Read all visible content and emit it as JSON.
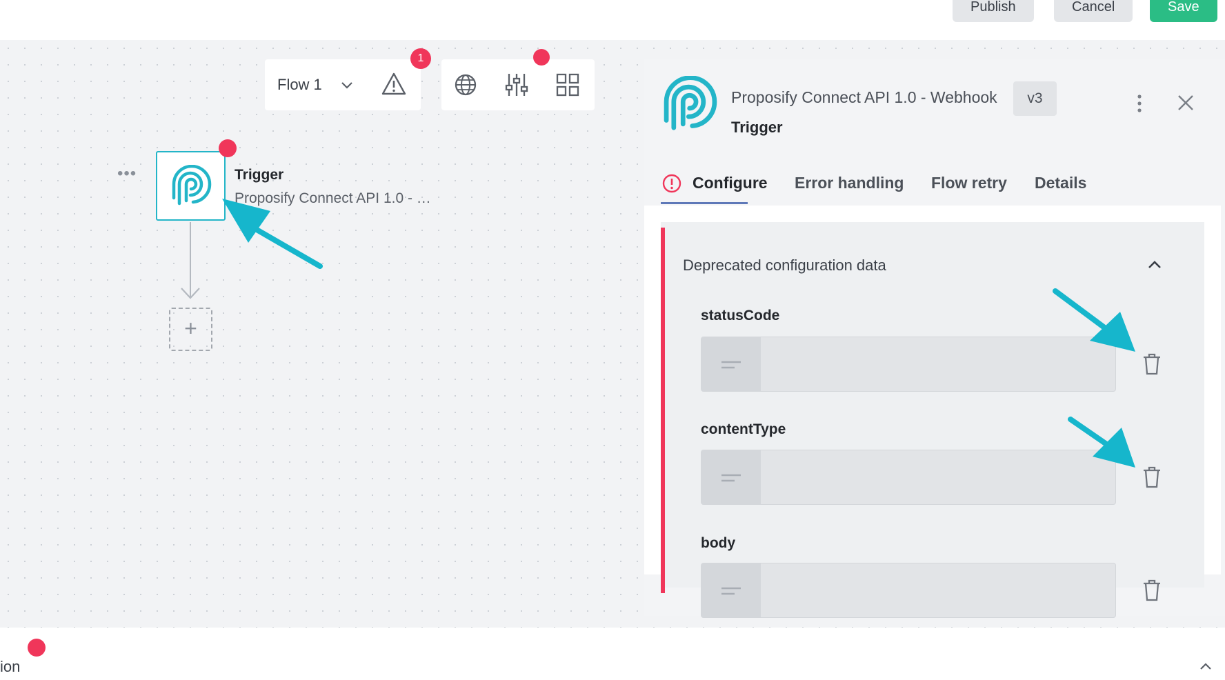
{
  "header": {
    "publish_label": "Publish",
    "cancel_label": "Cancel",
    "save_label": "Save"
  },
  "toolbar": {
    "flow_name": "Flow 1",
    "warning_count": "1"
  },
  "node": {
    "title": "Trigger",
    "subtitle": "Proposify Connect API 1.0 - …",
    "more_label": "•••",
    "add_label": "+"
  },
  "panel": {
    "app_title": "Proposify Connect API 1.0 - Webhook",
    "version": "v3",
    "subtitle": "Trigger",
    "tabs": [
      {
        "label": "Configure"
      },
      {
        "label": "Error handling"
      },
      {
        "label": "Flow retry"
      },
      {
        "label": "Details"
      }
    ],
    "section_title": "Deprecated configuration data",
    "fields": [
      {
        "label": "statusCode",
        "value": ""
      },
      {
        "label": "contentType",
        "value": ""
      },
      {
        "label": "body",
        "value": ""
      }
    ]
  },
  "bottom": {
    "label": "ion"
  },
  "colors": {
    "accent_teal": "#23b5c8",
    "error_red": "#f0365a",
    "save_green": "#2bbd85",
    "tab_underline": "#5e78b8"
  }
}
